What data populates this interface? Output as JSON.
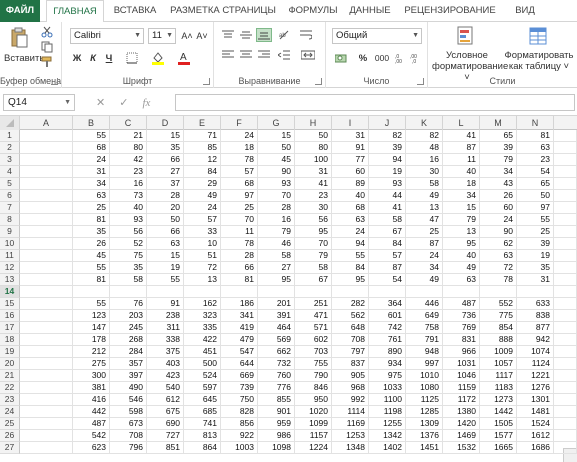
{
  "tabs": [
    {
      "label": "ФАЙЛ"
    },
    {
      "label": "ГЛАВНАЯ"
    },
    {
      "label": "ВСТАВКА"
    },
    {
      "label": "РАЗМЕТКА СТРАНИЦЫ"
    },
    {
      "label": "ФОРМУЛЫ"
    },
    {
      "label": "ДАННЫЕ"
    },
    {
      "label": "РЕЦЕНЗИРОВАНИЕ"
    },
    {
      "label": "ВИД"
    }
  ],
  "ribbon": {
    "clipboard": {
      "label": "Буфер обмена",
      "paste": "Вставить"
    },
    "font": {
      "label": "Шрифт",
      "name": "Calibri",
      "size": "11",
      "bold": "Ж",
      "italic": "К",
      "underline": "Ч",
      "grow": "A˄",
      "shrink": "A˅"
    },
    "alignment": {
      "label": "Выравнивание"
    },
    "number": {
      "label": "Число",
      "format": "Общий",
      "percent": "%",
      "thousands": "000"
    },
    "styles": {
      "label": "Стили",
      "conditional": "Условное форматирование ˅",
      "table": "Форматировать как таблицу ˅"
    }
  },
  "formula_bar": {
    "name_box": "Q14",
    "cancel": "✕",
    "enter": "✓",
    "fx": "fx",
    "formula": ""
  },
  "columns": [
    "A",
    "B",
    "C",
    "D",
    "E",
    "F",
    "G",
    "H",
    "I",
    "J",
    "K",
    "L",
    "M",
    "N"
  ],
  "selected_row": "14",
  "rows": [
    {
      "n": "1",
      "v": [
        "",
        "55",
        "21",
        "15",
        "71",
        "24",
        "15",
        "50",
        "31",
        "82",
        "82",
        "41",
        "65",
        "81"
      ]
    },
    {
      "n": "2",
      "v": [
        "",
        "68",
        "80",
        "35",
        "85",
        "18",
        "50",
        "80",
        "91",
        "39",
        "48",
        "87",
        "39",
        "63"
      ]
    },
    {
      "n": "3",
      "v": [
        "",
        "24",
        "42",
        "66",
        "12",
        "78",
        "45",
        "100",
        "77",
        "94",
        "16",
        "11",
        "79",
        "23"
      ]
    },
    {
      "n": "4",
      "v": [
        "",
        "31",
        "23",
        "27",
        "84",
        "57",
        "90",
        "31",
        "60",
        "19",
        "30",
        "40",
        "34",
        "54"
      ]
    },
    {
      "n": "5",
      "v": [
        "",
        "34",
        "16",
        "37",
        "29",
        "68",
        "93",
        "41",
        "89",
        "93",
        "58",
        "18",
        "43",
        "65"
      ]
    },
    {
      "n": "6",
      "v": [
        "",
        "63",
        "73",
        "28",
        "49",
        "97",
        "70",
        "23",
        "40",
        "44",
        "49",
        "34",
        "26",
        "50"
      ]
    },
    {
      "n": "7",
      "v": [
        "",
        "25",
        "40",
        "20",
        "24",
        "25",
        "28",
        "30",
        "68",
        "41",
        "13",
        "15",
        "60",
        "97"
      ]
    },
    {
      "n": "8",
      "v": [
        "",
        "81",
        "93",
        "50",
        "57",
        "70",
        "16",
        "56",
        "63",
        "58",
        "47",
        "79",
        "24",
        "55"
      ]
    },
    {
      "n": "9",
      "v": [
        "",
        "35",
        "56",
        "66",
        "33",
        "11",
        "79",
        "95",
        "24",
        "67",
        "25",
        "13",
        "90",
        "25"
      ]
    },
    {
      "n": "10",
      "v": [
        "",
        "26",
        "52",
        "63",
        "10",
        "78",
        "46",
        "70",
        "94",
        "84",
        "87",
        "95",
        "62",
        "39"
      ]
    },
    {
      "n": "11",
      "v": [
        "",
        "45",
        "75",
        "15",
        "51",
        "28",
        "58",
        "79",
        "55",
        "57",
        "24",
        "40",
        "63",
        "19"
      ]
    },
    {
      "n": "12",
      "v": [
        "",
        "55",
        "35",
        "19",
        "72",
        "66",
        "27",
        "58",
        "84",
        "87",
        "34",
        "49",
        "72",
        "35"
      ]
    },
    {
      "n": "13",
      "v": [
        "",
        "81",
        "58",
        "55",
        "13",
        "81",
        "95",
        "67",
        "95",
        "54",
        "49",
        "63",
        "78",
        "31"
      ]
    },
    {
      "n": "14",
      "v": [
        "",
        "",
        "",
        "",
        "",
        "",
        "",
        "",
        "",
        "",
        "",
        "",
        "",
        ""
      ]
    },
    {
      "n": "15",
      "v": [
        "",
        "55",
        "76",
        "91",
        "162",
        "186",
        "201",
        "251",
        "282",
        "364",
        "446",
        "487",
        "552",
        "633"
      ]
    },
    {
      "n": "16",
      "v": [
        "",
        "123",
        "203",
        "238",
        "323",
        "341",
        "391",
        "471",
        "562",
        "601",
        "649",
        "736",
        "775",
        "838"
      ]
    },
    {
      "n": "17",
      "v": [
        "",
        "147",
        "245",
        "311",
        "335",
        "419",
        "464",
        "571",
        "648",
        "742",
        "758",
        "769",
        "854",
        "877"
      ]
    },
    {
      "n": "18",
      "v": [
        "",
        "178",
        "268",
        "338",
        "422",
        "479",
        "569",
        "602",
        "708",
        "761",
        "791",
        "831",
        "888",
        "942"
      ]
    },
    {
      "n": "19",
      "v": [
        "",
        "212",
        "284",
        "375",
        "451",
        "547",
        "662",
        "703",
        "797",
        "890",
        "948",
        "966",
        "1009",
        "1074"
      ]
    },
    {
      "n": "20",
      "v": [
        "",
        "275",
        "357",
        "403",
        "500",
        "644",
        "732",
        "755",
        "837",
        "934",
        "997",
        "1031",
        "1057",
        "1124"
      ]
    },
    {
      "n": "21",
      "v": [
        "",
        "300",
        "397",
        "423",
        "524",
        "669",
        "760",
        "790",
        "905",
        "975",
        "1010",
        "1046",
        "1117",
        "1221"
      ]
    },
    {
      "n": "22",
      "v": [
        "",
        "381",
        "490",
        "540",
        "597",
        "739",
        "776",
        "846",
        "968",
        "1033",
        "1080",
        "1159",
        "1183",
        "1276"
      ]
    },
    {
      "n": "23",
      "v": [
        "",
        "416",
        "546",
        "612",
        "645",
        "750",
        "855",
        "950",
        "992",
        "1100",
        "1125",
        "1172",
        "1273",
        "1301"
      ]
    },
    {
      "n": "24",
      "v": [
        "",
        "442",
        "598",
        "675",
        "685",
        "828",
        "901",
        "1020",
        "1114",
        "1198",
        "1285",
        "1380",
        "1442",
        "1481"
      ]
    },
    {
      "n": "25",
      "v": [
        "",
        "487",
        "673",
        "690",
        "741",
        "856",
        "959",
        "1099",
        "1169",
        "1255",
        "1309",
        "1420",
        "1505",
        "1524"
      ]
    },
    {
      "n": "26",
      "v": [
        "",
        "542",
        "708",
        "727",
        "813",
        "922",
        "986",
        "1157",
        "1253",
        "1342",
        "1376",
        "1469",
        "1577",
        "1612"
      ]
    },
    {
      "n": "27",
      "v": [
        "",
        "623",
        "796",
        "851",
        "864",
        "1003",
        "1098",
        "1224",
        "1348",
        "1402",
        "1451",
        "1532",
        "1665",
        "1686"
      ]
    }
  ],
  "colors": {
    "accent": "#217346",
    "header_bg": "#f3f3f3",
    "grid_line": "#e2e2e2"
  }
}
